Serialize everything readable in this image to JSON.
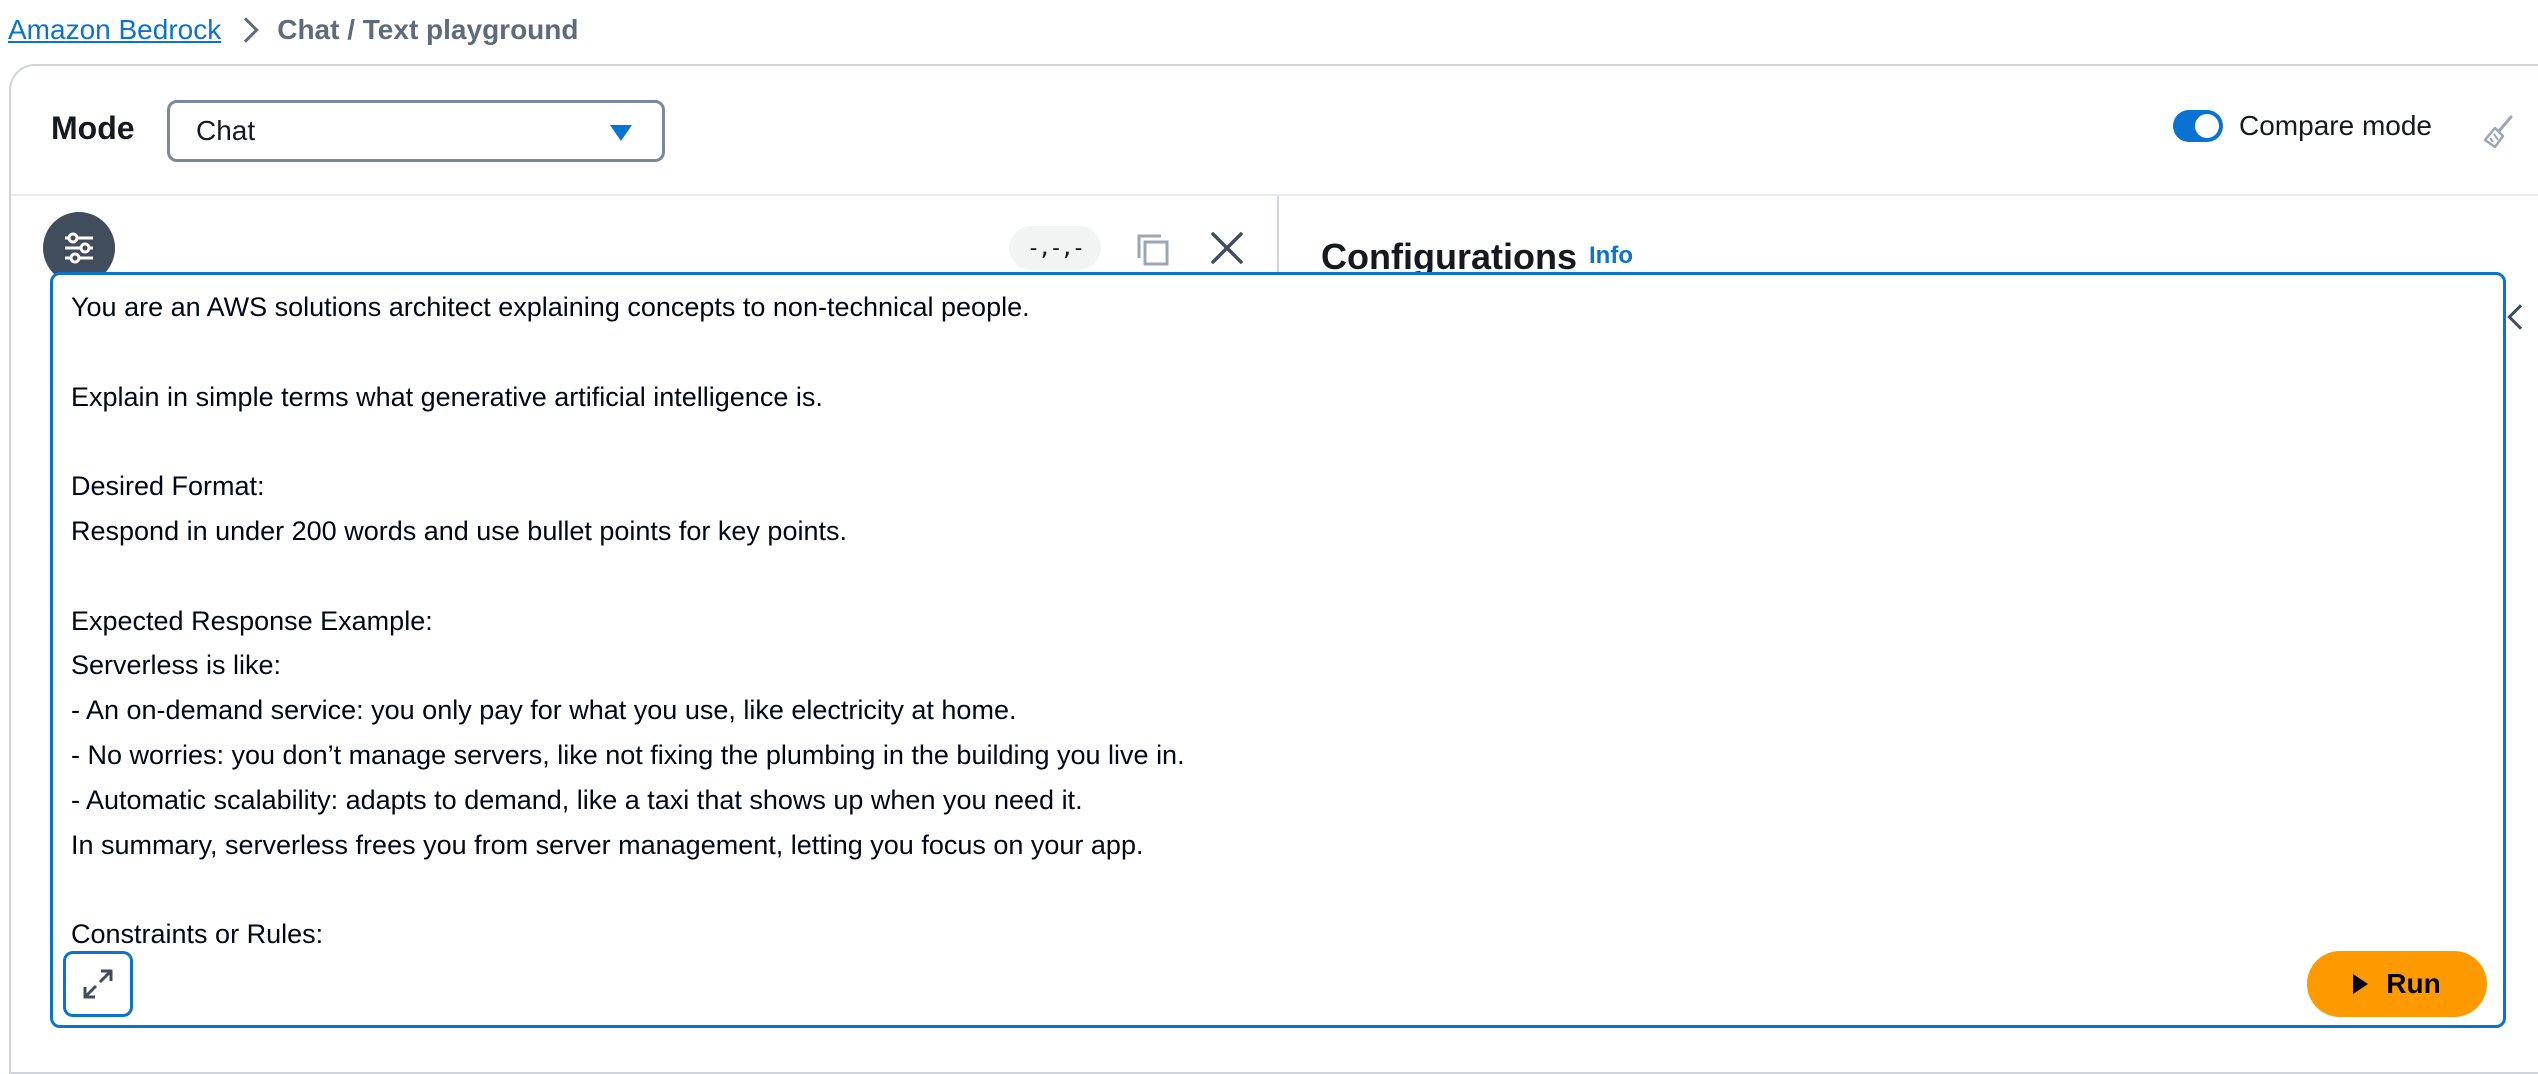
{
  "breadcrumb": {
    "root": "Amazon Bedrock",
    "current": "Chat / Text playground"
  },
  "mode": {
    "label": "Mode",
    "selected": "Chat"
  },
  "compare": {
    "label": "Compare mode",
    "enabled": true
  },
  "panel": {
    "dash_label": "-,-,-",
    "config_title": "Configurations",
    "info_label": "Info"
  },
  "prompt": {
    "text": "You are an AWS solutions architect explaining concepts to non-technical people.\n\nExplain in simple terms what generative artificial intelligence is.\n\nDesired Format:\nRespond in under 200 words and use bullet points for key points.\n\nExpected Response Example:\nServerless is like:\n- An on-demand service: you only pay for what you use, like electricity at home.\n- No worries: you don’t manage servers, like not fixing the plumbing in the building you live in.\n- Automatic scalability: adapts to demand, like a taxi that shows up when you need it.\nIn summary, serverless frees you from server management, letting you focus on your app.\n\nConstraints or Rules:"
  },
  "actions": {
    "run_label": "Run"
  },
  "colors": {
    "accent": "#0972d3",
    "run": "#ff9900"
  },
  "icons": {
    "settings": "sliders-icon",
    "copy": "copy-icon",
    "close": "close-icon",
    "clear": "broom-icon",
    "expand": "expand-icon",
    "play": "play-icon"
  }
}
